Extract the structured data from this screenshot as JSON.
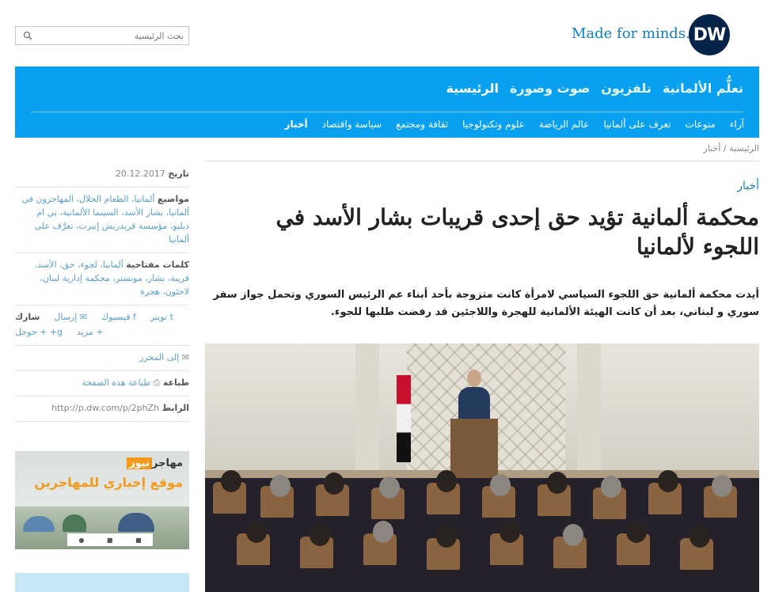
{
  "header": {
    "search_placeholder": "بحث الرئيسية",
    "tagline": "Made for minds.",
    "logo_text": "DW"
  },
  "nav": {
    "main": [
      "الرئيسية",
      "صوت وصورة",
      "تلفزيون",
      "تعلُّم الألمانية"
    ],
    "sub": [
      "أخبار",
      "سياسة واقتصاد",
      "ثقافة ومجتمع",
      "علوم وتكنولوجيا",
      "عالم الرياضة",
      "تعرف على ألمانيا",
      "منوعات",
      "آراء"
    ]
  },
  "breadcrumb": {
    "home": "الرئيسية",
    "sep": "/",
    "current": "أخبار"
  },
  "sidebar": {
    "date_label": "تاريخ",
    "date_value": "20.12.2017",
    "topics_label": "مواضيع",
    "topics_value": "ألمانيا، الطعام الحلال، المهاجرون في ألمانيا، بشار الأسد، السينما الألمانية، بي ام دبليو، مؤسسة فريدريش إيبرت، تعرَّف على ألمانيا",
    "keywords_label": "كلمات مفتاحية",
    "keywords_value": "ألمانيا، لجوء، حق، الأسد، قريبة، بشار، مونستر، محكمة إدارية لبنان، لاجئون، هجرة",
    "share_label": "شارك",
    "share_items": [
      "إرسال",
      "فيسبوك",
      "تويتر",
      "+ جوجل",
      "مزيد"
    ],
    "feedback": "إلى المحرر",
    "print_label": "طباعة",
    "print_link": "طباعة هذه الصفحة",
    "permalink_label": "الرابط",
    "permalink_value": "http://p.dw.com/p/2phZh"
  },
  "promo": {
    "title_prefix": "مهاجر",
    "title_highlight": "نيوز",
    "subtitle": "موقع إخباري للمهاجرين"
  },
  "article": {
    "kicker": "أخبار",
    "headline": "محكمة ألمانية تؤيد حق إحدى قريبات بشار الأسد في اللجوء لألمانيا",
    "lead": "أيدت محكمة ألمانية حق اللجوء السياسي لامرأة كانت متزوجة بأحد أبناء عم الرئيس السوري وتحمل جواز سفر سوري و لبناني، بعد أن كانت الهيئة الألمانية للهجرة واللاجئين قد رفضت طلبها للجوء."
  }
}
